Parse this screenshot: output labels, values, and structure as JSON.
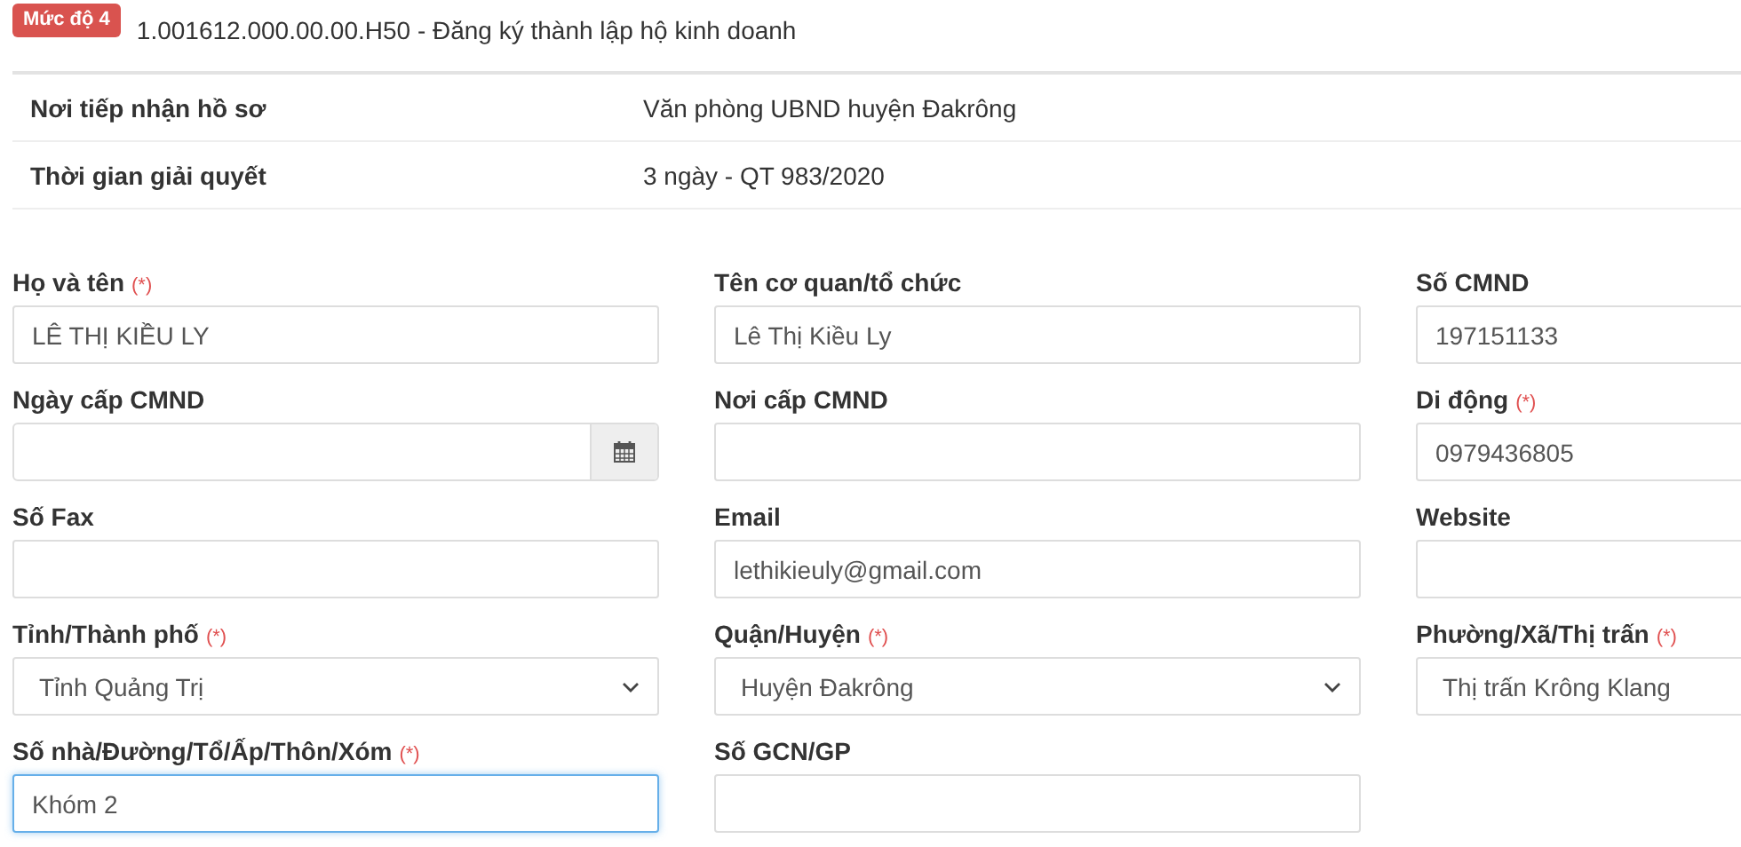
{
  "header": {
    "badge": "Mức độ 4",
    "title": "1.001612.000.00.00.H50 - Đăng ký thành lập hộ kinh doanh"
  },
  "info": [
    {
      "label": "Nơi tiếp nhận hồ sơ",
      "value": "Văn phòng UBND huyện Đakrông"
    },
    {
      "label": "Thời gian giải quyết",
      "value": "3 ngày - QT 983/2020"
    }
  ],
  "required_mark": "(*)",
  "fields": [
    {
      "kind": "text",
      "label": "Họ và tên",
      "required": true,
      "value": "LÊ THỊ KIỀU LY",
      "focused": false
    },
    {
      "kind": "text",
      "label": "Tên cơ quan/tổ chức",
      "required": false,
      "value": "Lê Thị Kiều Ly",
      "focused": false
    },
    {
      "kind": "text",
      "label": "Số CMND",
      "required": false,
      "value": "197151133",
      "focused": false
    },
    {
      "kind": "date",
      "label": "Ngày cấp CMND",
      "required": false,
      "focused": false
    },
    {
      "kind": "text",
      "label": "Nơi cấp CMND",
      "required": false,
      "focused": false
    },
    {
      "kind": "text",
      "label": "Di động",
      "required": true,
      "value": "0979436805",
      "focused": false
    },
    {
      "kind": "text",
      "label": "Số Fax",
      "required": false,
      "focused": false
    },
    {
      "kind": "text",
      "label": "Email",
      "required": false,
      "value": "lethikieuly@gmail.com",
      "focused": false
    },
    {
      "kind": "text",
      "label": "Website",
      "required": false,
      "focused": false
    },
    {
      "kind": "select",
      "label": "Tỉnh/Thành phố",
      "required": true,
      "value": "Tỉnh Quảng Trị",
      "focused": false
    },
    {
      "kind": "select",
      "label": "Quận/Huyện",
      "required": true,
      "value": "Huyện Đakrông",
      "focused": false
    },
    {
      "kind": "select",
      "label": "Phường/Xã/Thị trấn",
      "required": true,
      "value": "Thị trấn Krông Klang",
      "focused": false
    },
    {
      "kind": "text",
      "label": "Số nhà/Đường/Tổ/Ấp/Thôn/Xóm",
      "required": true,
      "value": "Khóm 2",
      "focused": true
    },
    {
      "kind": "text",
      "label": "Số GCN/GP",
      "required": false,
      "focused": false
    }
  ]
}
